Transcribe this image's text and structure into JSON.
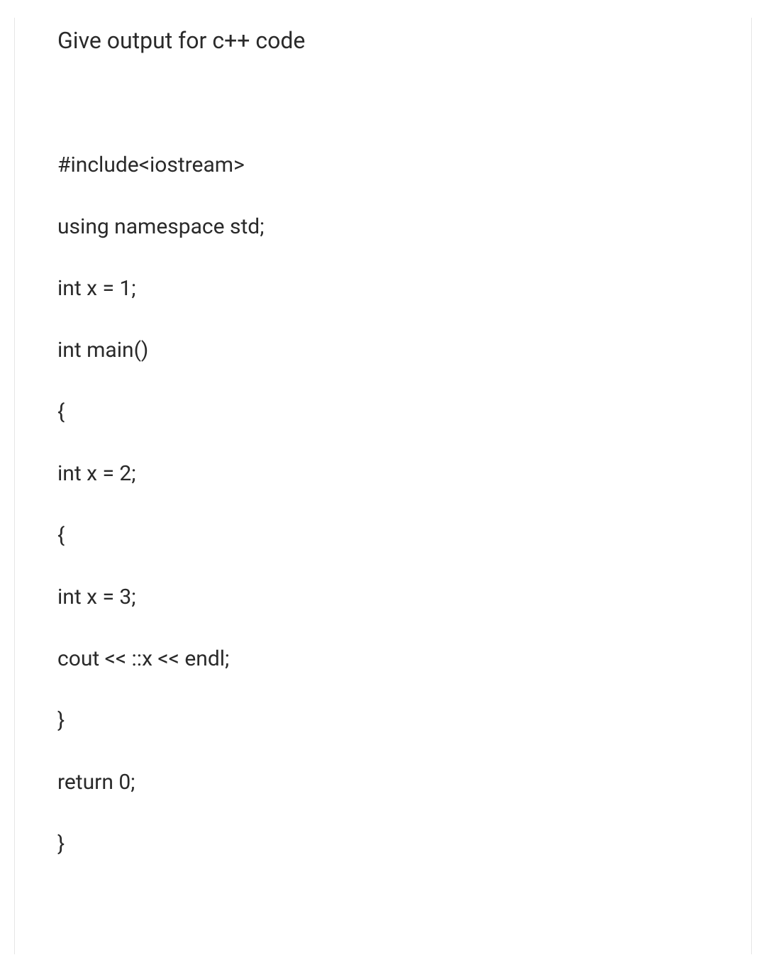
{
  "heading": "Give output for c++ code",
  "code": {
    "lines": [
      "#include<iostream>",
      "using namespace std;",
      "int x = 1;",
      "int main()",
      "{",
      "int x = 2;",
      "{",
      "int x = 3;",
      "cout << ::x << endl;",
      "}",
      "return 0;",
      "}"
    ]
  }
}
